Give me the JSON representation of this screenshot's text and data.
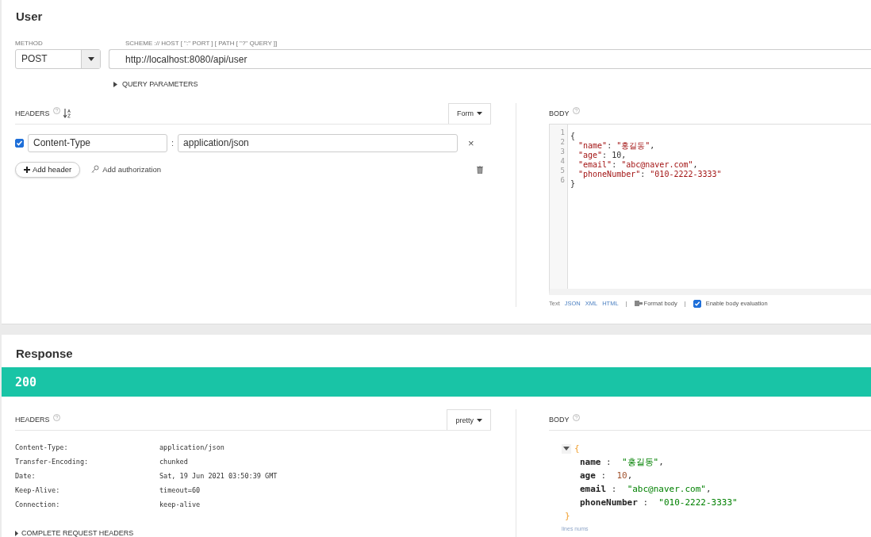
{
  "request": {
    "title": "User",
    "method": {
      "label": "METHOD",
      "value": "POST"
    },
    "url": {
      "label": "SCHEME :// HOST [ \":\" PORT ] [ PATH [ \"?\" QUERY ]]",
      "value": "http://localhost:8080/api/user"
    },
    "query_parameters": {
      "label": "QUERY PARAMETERS",
      "expanded": false
    },
    "headers": {
      "label": "HEADERS",
      "mode": "Form",
      "rows": [
        {
          "checked": true,
          "name": "Content-Type",
          "separator": ":",
          "value": "application/json",
          "remove": "×"
        }
      ],
      "add_header": "Add header",
      "add_authorization": "Add authorization"
    },
    "body": {
      "label": "BODY",
      "lines": [
        {
          "num": "1",
          "tokens": [
            {
              "kind": "punct",
              "text": "{"
            }
          ]
        },
        {
          "num": "2",
          "tokens": [
            {
              "kind": "key",
              "text": "\"name\""
            },
            {
              "kind": "punct",
              "text": ": "
            },
            {
              "kind": "string",
              "text": "\"홍길동\""
            },
            {
              "kind": "punct",
              "text": ","
            }
          ]
        },
        {
          "num": "3",
          "tokens": [
            {
              "kind": "key",
              "text": "\"age\""
            },
            {
              "kind": "punct",
              "text": ": "
            },
            {
              "kind": "number",
              "text": "10"
            },
            {
              "kind": "punct",
              "text": ","
            }
          ]
        },
        {
          "num": "4",
          "tokens": [
            {
              "kind": "key",
              "text": "\"email\""
            },
            {
              "kind": "punct",
              "text": ": "
            },
            {
              "kind": "string",
              "text": "\"abc@naver.com\""
            },
            {
              "kind": "punct",
              "text": ","
            }
          ]
        },
        {
          "num": "5",
          "tokens": [
            {
              "kind": "key",
              "text": "\"phoneNumber\""
            },
            {
              "kind": "punct",
              "text": ": "
            },
            {
              "kind": "string",
              "text": "\"010-2222-3333\""
            }
          ]
        },
        {
          "num": "6",
          "tokens": [
            {
              "kind": "punct",
              "text": "}"
            }
          ]
        }
      ],
      "formats": [
        {
          "label": "Text",
          "selected": true
        },
        {
          "label": "JSON",
          "selected": false
        },
        {
          "label": "XML",
          "selected": false
        },
        {
          "label": "HTML",
          "selected": false
        }
      ],
      "divider": "|",
      "format_body": "Format body",
      "evaluation": {
        "label": "Enable body evaluation",
        "checked": true
      }
    }
  },
  "response": {
    "title": "Response",
    "status": "200",
    "headers": {
      "label": "HEADERS",
      "mode": "pretty",
      "rows": [
        {
          "name": "Content-Type:",
          "value": "application/json"
        },
        {
          "name": "Transfer-Encoding:",
          "value": "chunked"
        },
        {
          "name": "Date:",
          "value": "Sat, 19 Jun 2021 03:50:39 GMT"
        },
        {
          "name": "Keep-Alive:",
          "value": "timeout=60"
        },
        {
          "name": "Connection:",
          "value": "keep-alive"
        }
      ],
      "complete_request_headers": "COMPLETE REQUEST HEADERS"
    },
    "body": {
      "label": "BODY",
      "open": "{",
      "close": "}",
      "expanded": true,
      "fields": [
        {
          "key": "name",
          "colon": ":",
          "value": "\"홍길동\"",
          "kind": "string",
          "comma": ","
        },
        {
          "key": "age",
          "colon": ":",
          "value": "10",
          "kind": "number",
          "comma": ","
        },
        {
          "key": "email",
          "colon": ":",
          "value": "\"abc@naver.com\"",
          "kind": "string",
          "comma": ","
        },
        {
          "key": "phoneNumber",
          "colon": ":",
          "value": "\"010-2222-3333\"",
          "kind": "string"
        }
      ],
      "footer": "lines nums"
    }
  }
}
